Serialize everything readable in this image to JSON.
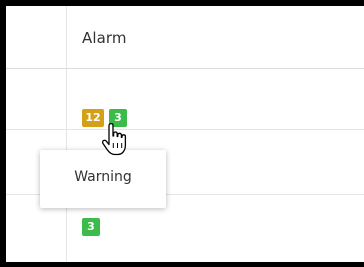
{
  "table": {
    "header": {
      "alarm_label": "Alarm"
    },
    "rows": [
      {
        "badges": [
          {
            "value": "12",
            "status": "warning"
          },
          {
            "value": "3",
            "status": "ok"
          }
        ]
      },
      {
        "badges": []
      },
      {
        "badges": [
          {
            "value": "3",
            "status": "ok"
          }
        ]
      }
    ]
  },
  "tooltip": {
    "text": "Warning"
  },
  "colors": {
    "warning": "#d4a017",
    "ok": "#3dbb4a"
  },
  "icons": {
    "cursor": "hand-pointer-icon"
  }
}
